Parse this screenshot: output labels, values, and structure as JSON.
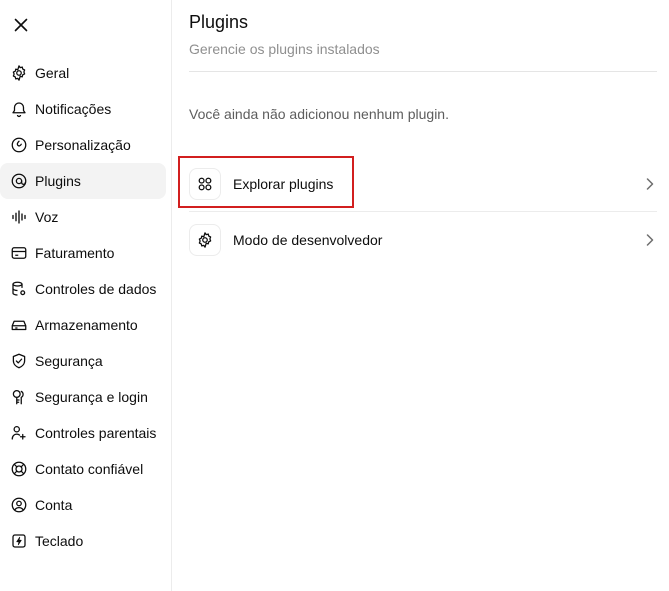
{
  "sidebar": {
    "items": [
      {
        "label": "Geral",
        "icon": "gear-icon"
      },
      {
        "label": "Notificações",
        "icon": "bell-icon"
      },
      {
        "label": "Personalização",
        "icon": "personalization-icon"
      },
      {
        "label": "Plugins",
        "icon": "plugin-icon",
        "active": true
      },
      {
        "label": "Voz",
        "icon": "voice-waveform-icon"
      },
      {
        "label": "Faturamento",
        "icon": "credit-card-icon"
      },
      {
        "label": "Controles de dados",
        "icon": "database-gear-icon"
      },
      {
        "label": "Armazenamento",
        "icon": "storage-icon"
      },
      {
        "label": "Segurança",
        "icon": "shield-check-icon"
      },
      {
        "label": "Segurança e login",
        "icon": "key-icon"
      },
      {
        "label": "Controles parentais",
        "icon": "parental-controls-icon"
      },
      {
        "label": "Contato confiável",
        "icon": "lifebuoy-icon"
      },
      {
        "label": "Conta",
        "icon": "user-circle-icon"
      },
      {
        "label": "Teclado",
        "icon": "lightning-key-icon"
      }
    ]
  },
  "main": {
    "title": "Plugins",
    "subtitle": "Gerencie os plugins instalados",
    "empty_message": "Você ainda não adicionou nenhum plugin.",
    "rows": [
      {
        "label": "Explorar plugins",
        "icon": "grid-icon"
      },
      {
        "label": "Modo de desenvolvedor",
        "icon": "gear-icon"
      }
    ]
  },
  "highlight_color": "#d21f1f"
}
